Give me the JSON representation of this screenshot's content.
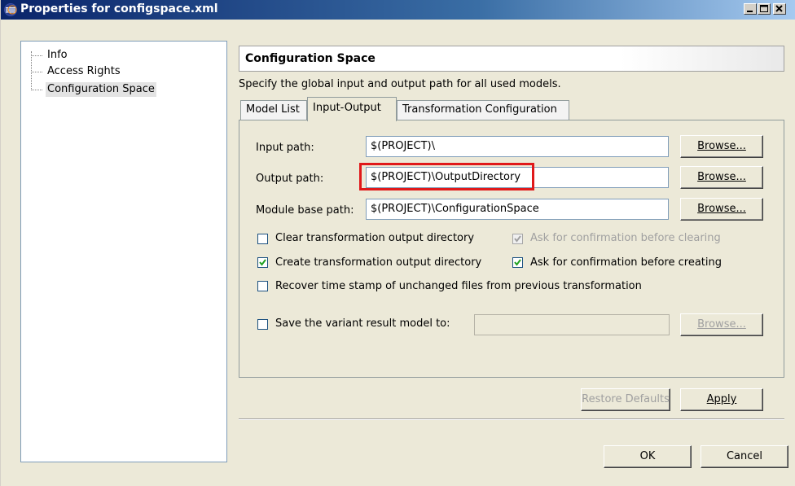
{
  "window": {
    "title": "Properties for configspace.xml"
  },
  "tree": {
    "items": [
      {
        "label": "Info"
      },
      {
        "label": "Access Rights"
      },
      {
        "label": "Configuration Space"
      }
    ]
  },
  "page": {
    "header": "Configuration Space",
    "description": "Specify the global input and output path for all used models."
  },
  "tabs": [
    {
      "label": "Model List"
    },
    {
      "label": "Input-Output"
    },
    {
      "label": "Transformation Configuration"
    }
  ],
  "form": {
    "input_path": {
      "label": "Input path:",
      "value": "$(PROJECT)\\",
      "browse": "Browse..."
    },
    "output_path": {
      "label": "Output path:",
      "value": "$(PROJECT)\\OutputDirectory",
      "browse": "Browse..."
    },
    "module_base_path": {
      "label": "Module base path:",
      "value": "$(PROJECT)\\ConfigurationSpace",
      "browse": "Browse..."
    },
    "checkboxes": {
      "clear_output": {
        "label": "Clear transformation output directory",
        "checked": false
      },
      "ask_before_clearing": {
        "label": "Ask for confirmation before clearing",
        "checked": true,
        "disabled": true
      },
      "create_output": {
        "label": "Create transformation output directory",
        "checked": true
      },
      "ask_before_creating": {
        "label": "Ask for confirmation before creating",
        "checked": true
      },
      "recover_timestamp": {
        "label": "Recover time stamp of unchanged files from previous transformation",
        "checked": false
      },
      "save_variant": {
        "label": "Save the variant result model to:",
        "checked": false
      }
    },
    "save_variant_value": "",
    "save_variant_browse": "Browse..."
  },
  "buttons": {
    "restore_defaults": "Restore Defaults",
    "apply": "Apply",
    "ok": "OK",
    "cancel": "Cancel"
  },
  "colors": {
    "highlight": "#e0191b",
    "titlebar": "#0a246a"
  }
}
